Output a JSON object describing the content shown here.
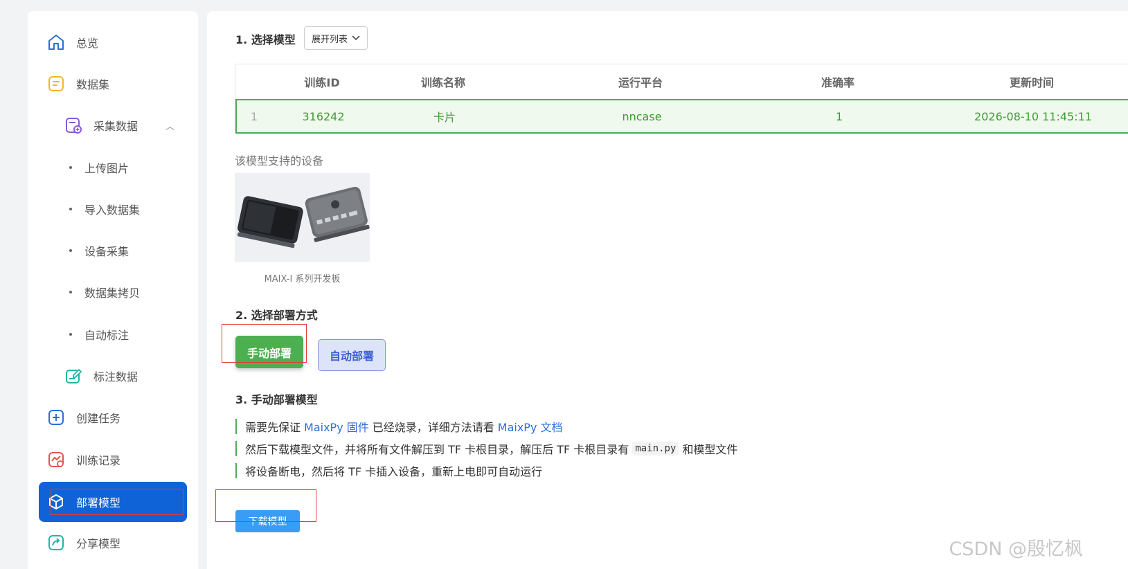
{
  "sidebar": {
    "overview": "总览",
    "dataset": "数据集",
    "collect_data": "采集数据",
    "collect_children": [
      "上传图片",
      "导入数据集",
      "设备采集",
      "数据集拷贝",
      "自动标注"
    ],
    "label_data": "标注数据",
    "create_task": "创建任务",
    "train_records": "训练记录",
    "deploy_model": "部署模型",
    "share_model": "分享模型"
  },
  "step1": {
    "title": "1. 选择模型",
    "dropdown": "展开列表",
    "table": {
      "headers": [
        "训练ID",
        "训练名称",
        "运行平台",
        "准确率",
        "更新时间"
      ],
      "rows": [
        {
          "index": "1",
          "id": "316242",
          "name": "卡片",
          "platform": "nncase",
          "accuracy": "1",
          "updated": "2026-08-10 11:45:11"
        }
      ]
    },
    "support_label": "该模型支持的设备",
    "device_caption": "MAIX-I 系列开发板"
  },
  "step2": {
    "title": "2. 选择部署方式",
    "manual": "手动部署",
    "auto": "自动部署"
  },
  "step3": {
    "title": "3. 手动部署模型",
    "line1_a": "需要先保证",
    "line1_link1": "MaixPy 固件",
    "line1_b": "已经烧录，详细方法请看",
    "line1_link2": "MaixPy 文档",
    "line2_a": "然后下载模型文件，并将所有文件解压到 TF 卡根目录，解压后 TF 卡根目录有",
    "line2_code": "main.py",
    "line2_b": "和模型文件",
    "line3": "将设备断电，然后将 TF 卡插入设备，重新上电即可自动运行",
    "download": "下载模型"
  },
  "watermark": "CSDN @殷忆枫",
  "colors": {
    "active": "#0f63d6",
    "success": "#4caf50",
    "link": "#2b6fd8",
    "annotation": "#e53935"
  }
}
